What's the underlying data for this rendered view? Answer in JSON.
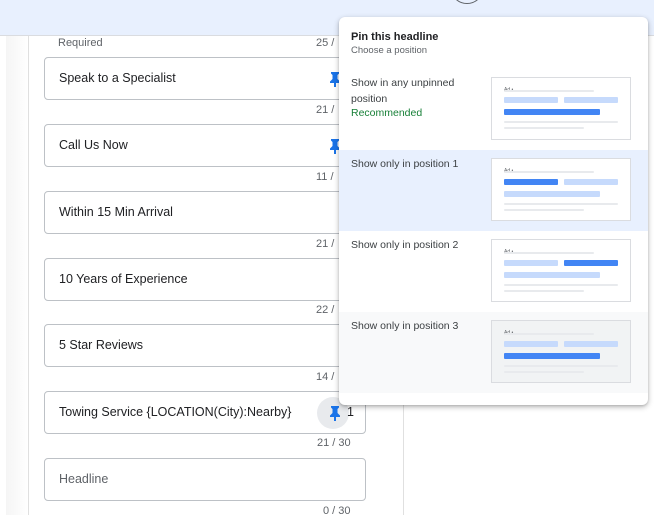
{
  "form": {
    "required_label": "Required",
    "fields": [
      {
        "text": "Speak to a Specialist",
        "counter": "25 /",
        "pinned": true
      },
      {
        "text": "Call Us Now",
        "counter": "21 /",
        "pinned": true
      },
      {
        "text": "Within 15 Min Arrival",
        "counter": "11 /",
        "pinned": false
      },
      {
        "text": "10 Years of Experience",
        "counter": "21 /",
        "pinned": false
      },
      {
        "text": "5 Star Reviews",
        "counter": "22 /",
        "pinned": false
      },
      {
        "text": "Towing Service {LOCATION(City):Nearby}",
        "counter": "14 /",
        "pinned": true,
        "pin_count": "1"
      },
      {
        "text": "Headline",
        "counter": "21 / 30",
        "placeholder": true
      }
    ],
    "last_counter": "0 / 30"
  },
  "popup": {
    "title": "Pin this headline",
    "subtitle": "Choose a position",
    "options": [
      {
        "label": "Show in any unpinned position",
        "note": "Recommended",
        "selected": false
      },
      {
        "label": "Show only in position 1",
        "selected": true
      },
      {
        "label": "Show only in position 2",
        "selected": false
      },
      {
        "label": "Show only in position 3",
        "selected": false
      }
    ],
    "preview_ad_label": "Ad •"
  },
  "colors": {
    "accent_blue": "#4285f4",
    "light_blue": "#c6dafc",
    "recommended_green": "#188038",
    "selected_bg": "#e8f0fe"
  }
}
